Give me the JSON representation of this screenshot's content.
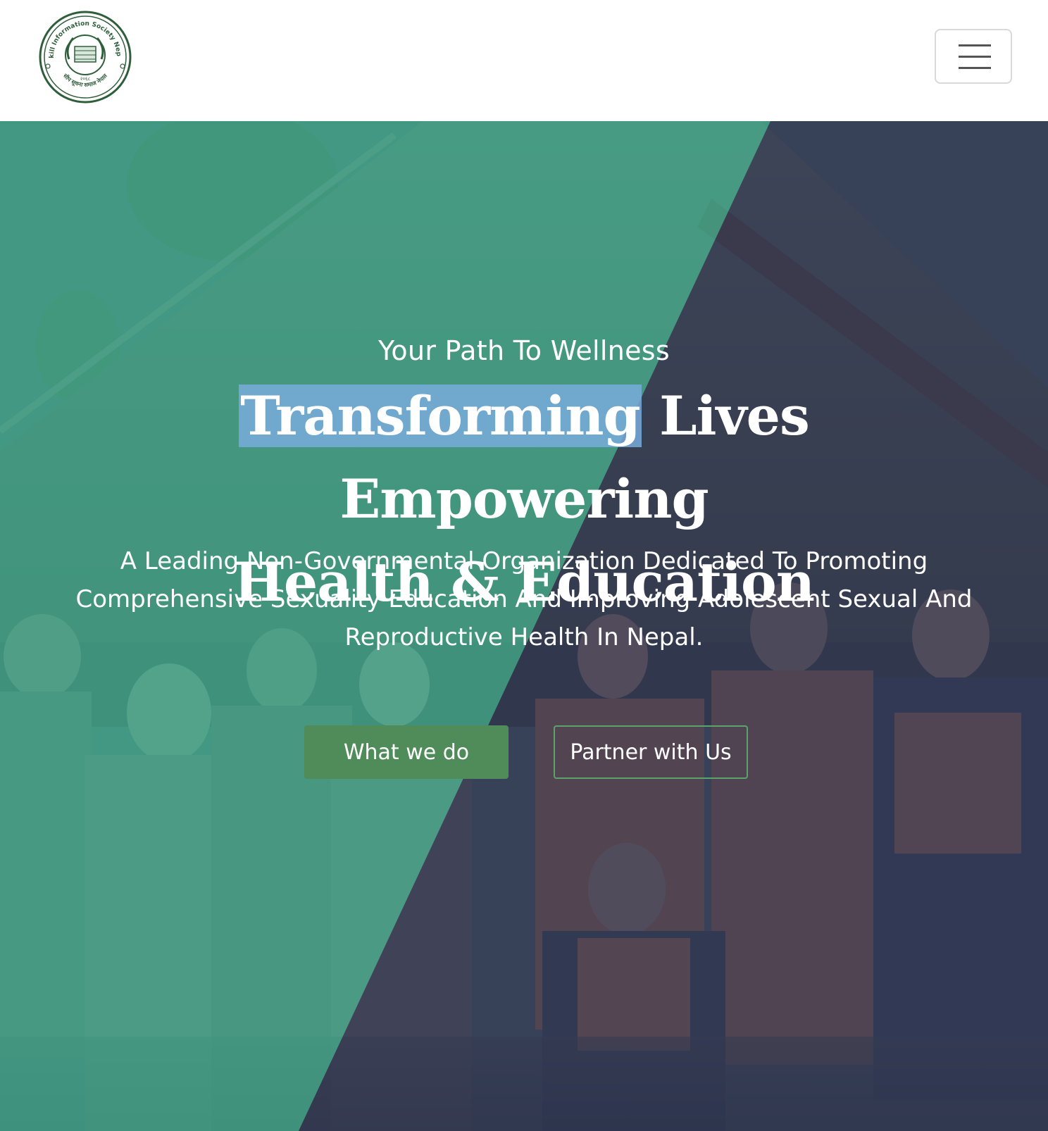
{
  "header": {
    "logo_text_top": "Skill Information Society Nepal",
    "logo_text_bottom": "सीप सूचना समाज नेपाल",
    "logo_year": "२०६८",
    "menu_icon": "hamburger-menu-icon"
  },
  "hero": {
    "eyebrow": "Your Path To Wellness",
    "headline_highlight": "Transforming",
    "headline_rest_line1": " Lives Empowering",
    "headline_line2": "Health & Education",
    "lead": "A Leading Non-Governmental Organization Dedicated To Promoting Comprehensive Sexuality Education And Improving Adolescent Sexual And Reproductive Health In Nepal.",
    "primary_button": "What we do",
    "secondary_button": "Partner with Us"
  },
  "colors": {
    "overlay_green": "#4a9a88",
    "overlay_dark": "#3a4257",
    "button_green": "#4f8c5a",
    "outline_green": "#5aa46a",
    "highlight": "#78aadc"
  }
}
